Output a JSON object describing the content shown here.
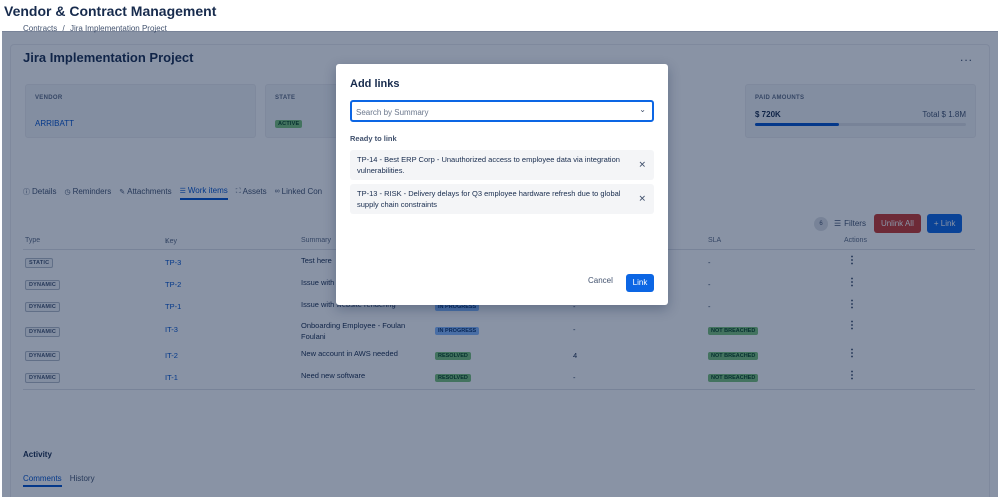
{
  "app": {
    "title": "Vendor & Contract Management"
  },
  "breadcrumb": {
    "root": "Contracts",
    "separator": "/",
    "current": "Jira Implementation Project"
  },
  "page": {
    "title": "Jira Implementation Project",
    "more": "..."
  },
  "cards": {
    "vendor": {
      "label": "VENDOR",
      "value": "ARRIBATT"
    },
    "state": {
      "label": "STATE",
      "value": "ACTIVE"
    },
    "paid": {
      "label": "PAID AMOUNTS",
      "value": "$ 720K",
      "total": "Total $ 1.8M",
      "progress": 0.4
    }
  },
  "tabs": [
    {
      "label": "Details",
      "icon": "info-icon"
    },
    {
      "label": "Reminders",
      "icon": "clock-icon"
    },
    {
      "label": "Attachments",
      "icon": "paperclip-icon"
    },
    {
      "label": "Work items",
      "icon": "list-icon"
    },
    {
      "label": "Assets",
      "icon": "assets-icon"
    },
    {
      "label": "Linked Con",
      "icon": "link-icon"
    }
  ],
  "toolbar": {
    "count": "6",
    "filters": "Filters",
    "unlink_all": "Unlink All",
    "link": "+ Link"
  },
  "table": {
    "headers": {
      "type": "Type",
      "key": "Key",
      "summary": "Summary",
      "sla": "SLA",
      "actions": "Actions"
    },
    "rows": [
      {
        "type": "STATIC",
        "key": "TP-3",
        "summary": "Test here",
        "status": "",
        "sub": "",
        "sla": "-"
      },
      {
        "type": "DYNAMIC",
        "key": "TP-2",
        "summary": "Issue with",
        "status": "",
        "sub": "-",
        "sla": "-"
      },
      {
        "type": "DYNAMIC",
        "key": "TP-1",
        "summary": "Issue with website rendering",
        "status": "IN PROGRESS",
        "sub": "-",
        "sla": "-"
      },
      {
        "type": "DYNAMIC",
        "key": "IT-3",
        "summary": "Onboarding Employee - Foulan Foulani",
        "status": "IN PROGRESS",
        "sub": "-",
        "sla": "NOT BREACHED"
      },
      {
        "type": "DYNAMIC",
        "key": "IT-2",
        "summary": "New account in AWS needed",
        "status": "RESOLVED",
        "sub": "4",
        "sla": "NOT BREACHED"
      },
      {
        "type": "DYNAMIC",
        "key": "IT-1",
        "summary": "Need new software",
        "status": "RESOLVED",
        "sub": "-",
        "sla": "NOT BREACHED"
      }
    ]
  },
  "activity": {
    "title": "Activity",
    "tab_comments": "Comments",
    "tab_history": "History"
  },
  "modal": {
    "title": "Add links",
    "search_placeholder": "Search by Summary",
    "ready_label": "Ready to link",
    "items": [
      "TP-14 - Best ERP Corp - Unauthorized access to employee data via integration vulnerabilities.",
      "TP-13 - RISK - Delivery delays for Q3 employee hardware refresh due to global supply chain constraints"
    ],
    "cancel": "Cancel",
    "link": "Link"
  }
}
